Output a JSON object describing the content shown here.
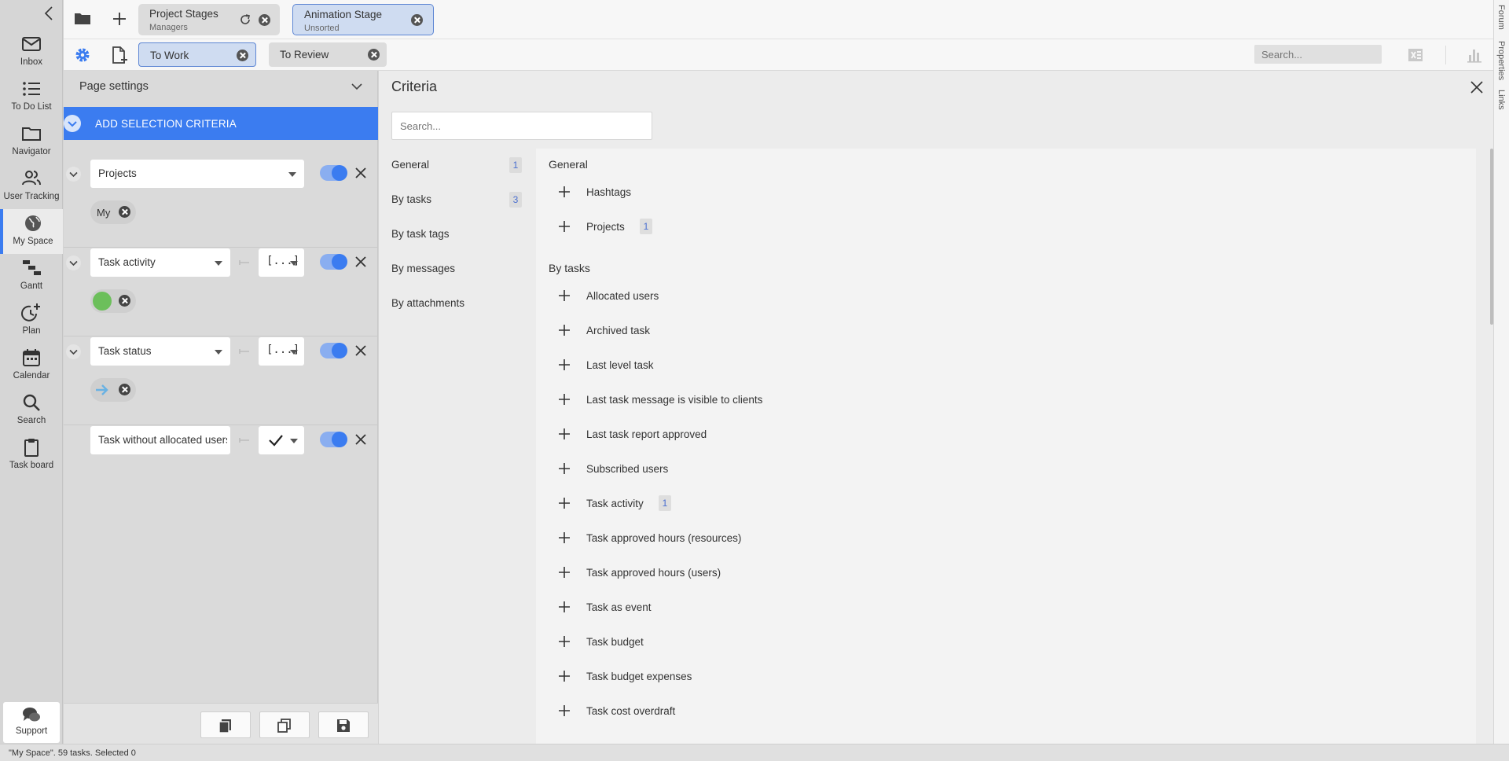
{
  "sidebar": {
    "items": [
      {
        "label": "Inbox",
        "icon": "mail-icon"
      },
      {
        "label": "To Do List",
        "icon": "list-icon"
      },
      {
        "label": "Navigator",
        "icon": "folder-icon"
      },
      {
        "label": "User Tracking",
        "icon": "users-icon"
      },
      {
        "label": "My Space",
        "icon": "globe-icon",
        "active": true
      },
      {
        "label": "Gantt",
        "icon": "gantt-icon"
      },
      {
        "label": "Plan",
        "icon": "plan-clock-icon"
      },
      {
        "label": "Calendar",
        "icon": "calendar-icon"
      },
      {
        "label": "Search",
        "icon": "search-icon"
      },
      {
        "label": "Task board",
        "icon": "clipboard-icon"
      }
    ],
    "support_label": "Support"
  },
  "tabs": [
    {
      "title": "Project Stages",
      "subtitle": "Managers"
    },
    {
      "title": "Animation Stage",
      "subtitle": "Unsorted",
      "selected": true
    }
  ],
  "filter_tabs": [
    {
      "label": "To Work",
      "selected": true
    },
    {
      "label": "To Review"
    }
  ],
  "toolbar": {
    "search_placeholder": "Search..."
  },
  "right_edge": {
    "tabs": [
      "Forum",
      "Properties",
      "Links"
    ]
  },
  "page_settings": {
    "title": "Page settings",
    "add_criteria_label": "ADD SELECTION CRITERIA",
    "rows": [
      {
        "field": "Projects",
        "chip": "My",
        "enabled": true
      },
      {
        "field": "Task activity",
        "operator": "[...]",
        "chip_icon": "green-dot-icon",
        "enabled": true
      },
      {
        "field": "Task status",
        "operator": "[...]",
        "chip_icon": "arrow-right-icon",
        "enabled": true
      },
      {
        "field": "Task without allocated users",
        "operator": "check-icon",
        "enabled": true
      }
    ]
  },
  "criteria": {
    "title": "Criteria",
    "search_placeholder": "Search...",
    "categories": [
      {
        "label": "General",
        "count": "1"
      },
      {
        "label": "By tasks",
        "count": "3"
      },
      {
        "label": "By task tags",
        "count": ""
      },
      {
        "label": "By messages",
        "count": ""
      },
      {
        "label": "By attachments",
        "count": ""
      }
    ],
    "groups": [
      {
        "label": "General",
        "items": [
          {
            "label": "Hashtags",
            "count": ""
          },
          {
            "label": "Projects",
            "count": "1"
          }
        ]
      },
      {
        "label": "By tasks",
        "items": [
          {
            "label": "Allocated users",
            "count": ""
          },
          {
            "label": "Archived task",
            "count": ""
          },
          {
            "label": "Last level task",
            "count": ""
          },
          {
            "label": "Last task message is visible to clients",
            "count": ""
          },
          {
            "label": "Last task report approved",
            "count": ""
          },
          {
            "label": "Subscribed users",
            "count": ""
          },
          {
            "label": "Task activity",
            "count": "1"
          },
          {
            "label": "Task approved hours (resources)",
            "count": ""
          },
          {
            "label": "Task approved hours (users)",
            "count": ""
          },
          {
            "label": "Task as event",
            "count": ""
          },
          {
            "label": "Task budget",
            "count": ""
          },
          {
            "label": "Task budget expenses",
            "count": ""
          },
          {
            "label": "Task cost overdraft",
            "count": ""
          }
        ]
      }
    ]
  },
  "status_bar": "\"My Space\". 59 tasks. Selected 0",
  "colors": {
    "accent": "#3b7cf0",
    "selected_tab_bg": "#cfdcf1",
    "panel_bg": "#dadada"
  }
}
